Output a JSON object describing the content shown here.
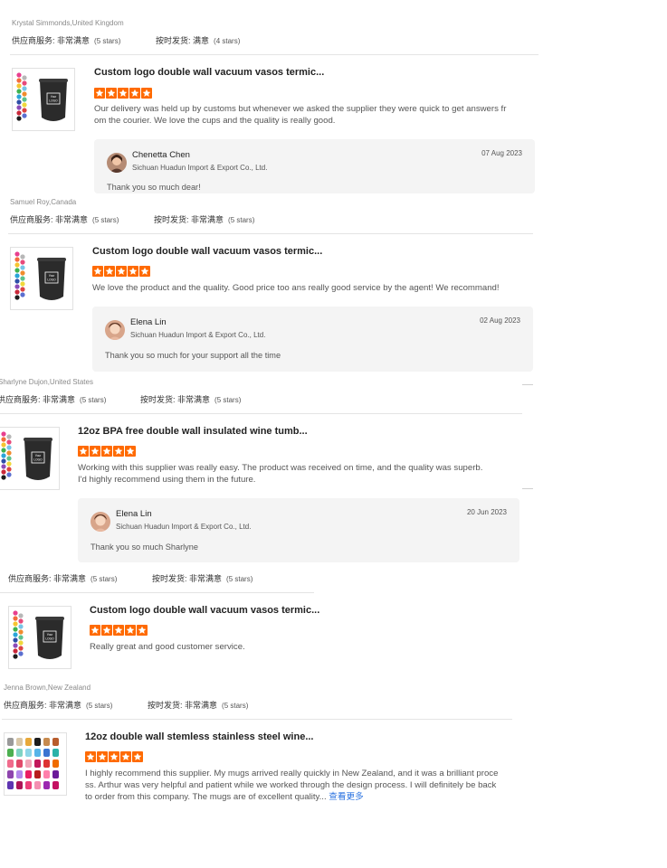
{
  "labels": {
    "supplier_service": "供应商服务:",
    "on_time": "按时发货:",
    "very_satisfied": "非常满意",
    "satisfied": "满意",
    "read_more": "查看更多"
  },
  "colors": {
    "star": "#ff6a00",
    "link": "#2b73e0",
    "reply_bg": "#f4f4f4"
  },
  "reviews": [
    {
      "reviewer": "Krystal Simmonds,United Kingdom",
      "service_rating": "非常满意",
      "service_stars": "(5 stars)",
      "shipping_rating": "满意",
      "shipping_stars": "(4 stars)",
      "product_title": "Custom logo double wall vacuum vasos termic...",
      "stars": 5,
      "comment_lines": [
        "Our delivery was held up by customs but whenever we asked the supplier they were quick to get answers fr",
        "om the courier. We love the cups and the quality is really good."
      ],
      "reply": {
        "name": "Chenetta Chen",
        "company": "Sichuan Huadun Import & Export Co., Ltd.",
        "date": "07 Aug 2023",
        "text": "Thank you so much dear!"
      }
    },
    {
      "reviewer": "Samuel Roy,Canada",
      "service_rating": "非常满意",
      "service_stars": "(5 stars)",
      "shipping_rating": "非常满意",
      "shipping_stars": "(5 stars)",
      "product_title": "Custom logo double wall vacuum vasos termic...",
      "stars": 5,
      "comment_lines": [
        "We love the product and the quality. Good price too ans really good service by the agent! We recommand!"
      ],
      "reply": {
        "name": "Elena Lin",
        "company": "Sichuan Huadun Import & Export Co., Ltd.",
        "date": "02 Aug 2023",
        "text": "Thank you so much for your support all the time"
      }
    },
    {
      "reviewer": "Sharlyne Dujon,United States",
      "service_rating": "非常满意",
      "service_stars": "(5 stars)",
      "shipping_rating": "非常满意",
      "shipping_stars": "(5 stars)",
      "product_title": "12oz BPA free double wall insulated wine tumb...",
      "stars": 5,
      "comment_lines": [
        "Working with this supplier was really easy. The product was received on time, and the quality was superb.",
        "I'd highly recommend using them in the future."
      ],
      "reply": {
        "name": "Elena Lin",
        "company": "Sichuan Huadun Import & Export Co., Ltd.",
        "date": "20 Jun 2023",
        "text": "Thank you so much Sharlyne"
      }
    },
    {
      "reviewer": "",
      "service_rating": "非常满意",
      "service_stars": "(5 stars)",
      "shipping_rating": "非常满意",
      "shipping_stars": "(5 stars)",
      "product_title": "Custom logo double wall vacuum vasos termic...",
      "stars": 5,
      "comment_lines": [
        "Really great and good customer service."
      ]
    },
    {
      "reviewer": "Jenna Brown,New Zealand",
      "service_rating": "非常满意",
      "service_stars": "(5 stars)",
      "shipping_rating": "非常满意",
      "shipping_stars": "(5 stars)",
      "product_title": "12oz double wall stemless stainless steel wine...",
      "stars": 5,
      "comment_lines": [
        "I highly recommend this supplier. My mugs arrived really quickly in New Zealand, and it was a brilliant proce",
        "ss. Arthur was very helpful and patient while we worked through the design process. I will definitely be back",
        "to order from this company. The mugs are of excellent quality..."
      ]
    }
  ]
}
